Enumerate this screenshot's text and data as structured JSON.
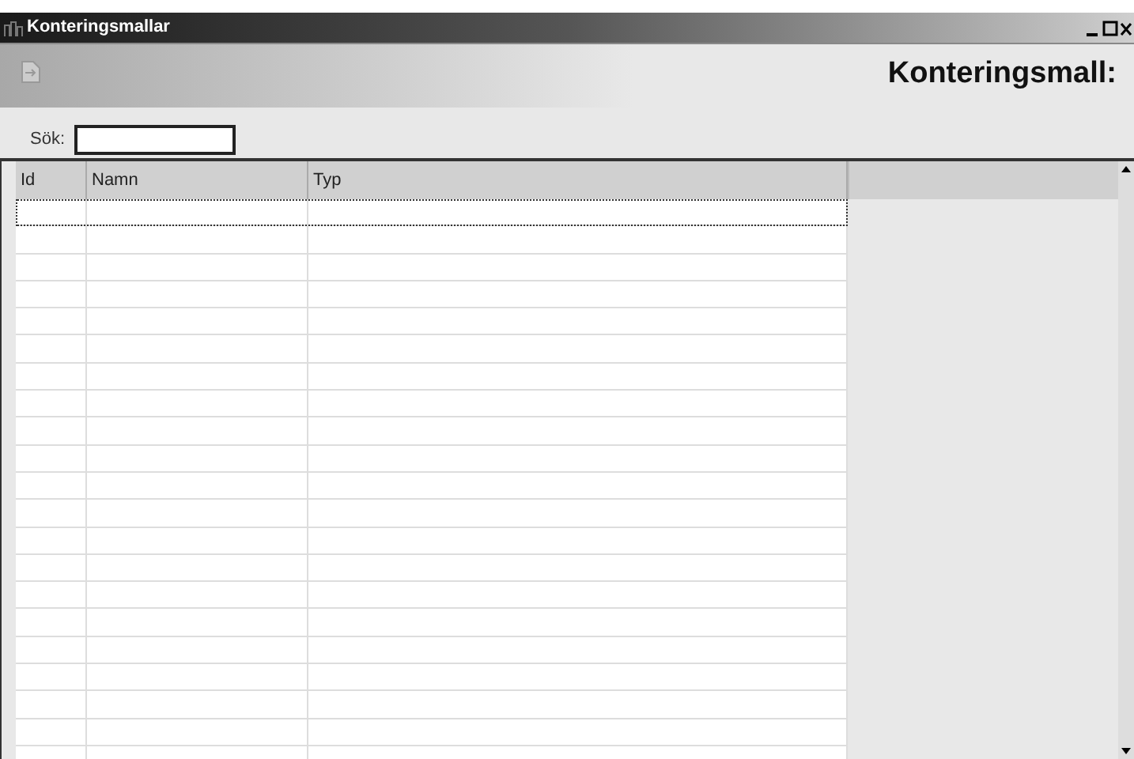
{
  "window": {
    "title": "Konteringsmallar"
  },
  "header": {
    "title": "Konteringsmall:"
  },
  "search": {
    "label": "Sök:"
  },
  "table": {
    "columns": [
      "Id",
      "Namn",
      "Typ"
    ]
  }
}
